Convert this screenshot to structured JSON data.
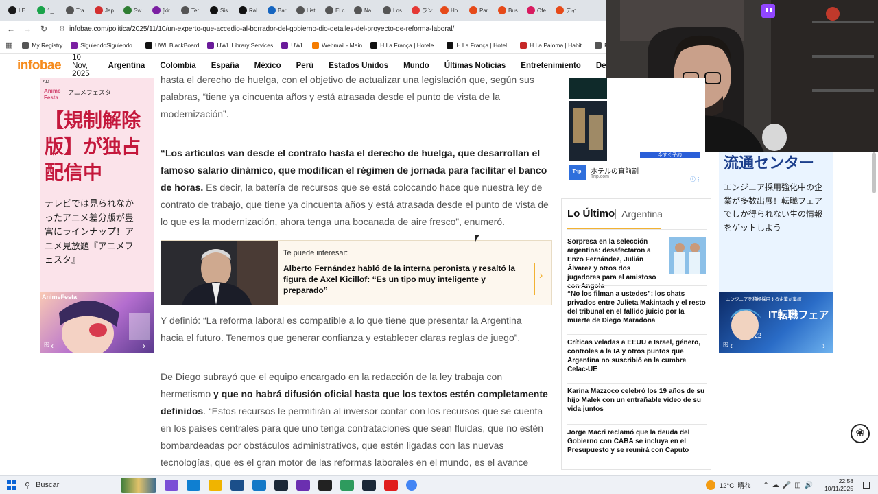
{
  "browser": {
    "tabs": [
      {
        "label": "LE",
        "color": "#1a1a1a"
      },
      {
        "label": "1_",
        "color": "#1aa34a"
      },
      {
        "label": "Tra",
        "color": "#555"
      },
      {
        "label": "Jap",
        "color": "#d32f2f"
      },
      {
        "label": "Sw",
        "color": "#2e7d32"
      },
      {
        "label": "[kir",
        "color": "#7b1fa2"
      },
      {
        "label": "Ter",
        "color": "#555"
      },
      {
        "label": "Sis",
        "color": "#111"
      },
      {
        "label": "Ral",
        "color": "#111"
      },
      {
        "label": "Bar",
        "color": "#1565c0"
      },
      {
        "label": "List",
        "color": "#555"
      },
      {
        "label": "El c",
        "color": "#555"
      },
      {
        "label": "Na",
        "color": "#555"
      },
      {
        "label": "Los",
        "color": "#555"
      },
      {
        "label": "ラン",
        "color": "#e53935"
      },
      {
        "label": "Ho",
        "color": "#e64a19"
      },
      {
        "label": "Par",
        "color": "#e64a19"
      },
      {
        "label": "Bus",
        "color": "#e64a19"
      },
      {
        "label": "Ofe",
        "color": "#d81b60"
      },
      {
        "label": "ティ",
        "color": "#e64a19"
      }
    ],
    "url": "infobae.com/politica/2025/11/10/un-experto-que-accedio-al-borrador-del-gobierno-dio-detalles-del-proyecto-de-reforma-laboral/",
    "bookmarks": [
      {
        "label": "My Registry",
        "color": "#555"
      },
      {
        "label": "SiguiendoSiguiendo...",
        "color": "#7b1fa2"
      },
      {
        "label": "UWL BlackBoard",
        "color": "#111"
      },
      {
        "label": "UWL Library Services",
        "color": "#6a1b9a"
      },
      {
        "label": "UWL",
        "color": "#6a1b9a"
      },
      {
        "label": "Webmail - Main",
        "color": "#f57c00"
      },
      {
        "label": "H La França | Hotele...",
        "color": "#111"
      },
      {
        "label": "H La França | Hotel...",
        "color": "#111"
      },
      {
        "label": "H La Paloma | Habit...",
        "color": "#c62828"
      },
      {
        "label": "Posiciones",
        "color": "#555"
      }
    ]
  },
  "site": {
    "logo": "infobae",
    "date": "10 Nov, 2025",
    "nav": [
      "Argentina",
      "Colombia",
      "España",
      "México",
      "Perú",
      "Estados Unidos",
      "Mundo",
      "Últimas Noticias",
      "Entretenimiento",
      "Deport"
    ]
  },
  "left_ad": {
    "badge": "AD",
    "brand": "Anime Festa",
    "brand_jp": "アニメフェスタ",
    "headline": "【規制解除版】が独占配信中",
    "body": "テレビでは見られなかったアニメ差分版が豊富にラインナップ！アニメ見放題『アニメフェスタ』",
    "banner_logo": "AnimeFesta",
    "close_label": "閉"
  },
  "article": {
    "p1": "hasta el derecho de huelga, con el objetivo de actualizar una legislación que, según sus palabras, “tiene ya cincuenta años y está atrasada desde el punto de vista de la modernización”.",
    "p2_bold": "“Los artículos van desde el contrato hasta el derecho de huelga, que desarrollan el famoso salario dinámico, que modifican el régimen de jornada para facilitar el banco de horas.",
    "p2_rest": " Es decir, la batería de recursos que se está colocando hace que nuestra ley de contrato de trabajo, que tiene ya cincuenta años y está atrasada desde el punto de vista de lo que es la modernización, ahora tenga una bocanada de aire fresco”, enumeró.",
    "promo_kicker": "Te puede interesar:",
    "promo_title": "Alberto Fernández habló de la interna peronista y resaltó la figura de Axel Kicillof: “Es un tipo muy inteligente y preparado”",
    "p3": "Y definió: “La reforma laboral es compatible a lo que tiene que presentar la Argentina hacia el futuro. Tenemos que generar confianza y establecer claras reglas de juego”.",
    "p4_a": "De Diego subrayó que el equipo encargado en la redacción de la ley trabaja con hermetismo",
    "p4_bold": " y que no habrá difusión oficial hasta que los textos estén completamente definidos",
    "p4_rest": ". “Estos recursos le permitirán al inversor contar con los recursos que se cuenta en los países centrales para que uno tenga contrataciones que sean fluidas, que no estén bombardeadas por obstáculos administrativos, que estén ligadas con las nuevas tecnologías, que es el gran motor de las reformas laborales en el mundo, es el avance"
  },
  "hotel_ad": {
    "button": "今すぐ予約",
    "text": "ホテルの直前割",
    "brand": "Trip.com",
    "logo": "Trip."
  },
  "latest": {
    "title": "Lo Último",
    "section": "Argentina",
    "items": [
      "Sorpresa en la selección argentina: desafectaron a Enzo Fernández, Julián Álvarez y otros dos jugadores para el amistoso con Angola",
      "“No los filman a ustedes”: los chats privados entre Julieta Makintach y el resto del tribunal en el fallido juicio por la muerte de Diego Maradona",
      "Críticas veladas a EEUU e Israel, género, controles a la IA y otros puntos que Argentina no suscribió en la cumbre Celac-UE",
      "Karina Mazzoco celebró los 19 años de su hijo Malek con un entrañable video de su vida juntos",
      "Jorge Macri reclamó que la deuda del Gobierno con CABA se incluya en el Presupuesto y se reunirá con Caputo"
    ]
  },
  "right_ad": {
    "headline": "流通センター",
    "body": "エンジニア採用強化中の企業が多数出展！転職フェアでしか得られない生の情報をゲットしよう",
    "banner_top": "エンジニアを積極採用する企業が集結",
    "banner_title": "IT転職フェア",
    "banner_date": "11/22",
    "close_label": "閉"
  },
  "taskbar": {
    "search": "Buscar",
    "weather": "12°C  晴れ",
    "time": "22:58",
    "date": "10/11/2025"
  }
}
